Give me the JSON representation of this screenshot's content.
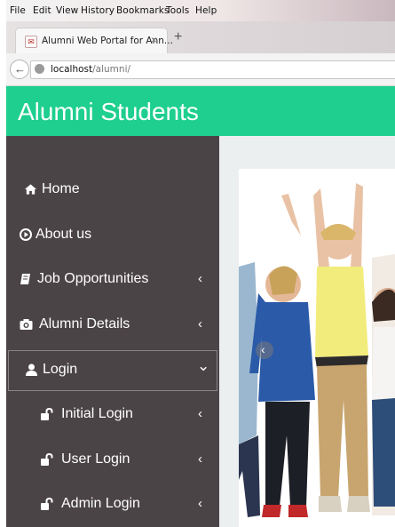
{
  "browser": {
    "menu": [
      "File",
      "Edit",
      "View",
      "History",
      "Bookmarks",
      "Tools",
      "Help"
    ],
    "tab": {
      "title": "Alumni Web Portal for Ann...",
      "close": "×"
    },
    "new_tab": "+",
    "url": {
      "host": "localhost",
      "path": "/alumni/"
    }
  },
  "header": {
    "brand": "Alumni Students",
    "color": "#1ecf8f"
  },
  "sidebar": {
    "background": "#4b4447",
    "items": [
      {
        "label": "Home",
        "icon": "home-icon",
        "chevron": ""
      },
      {
        "label": "About us",
        "icon": "play-circle-icon",
        "chevron": ""
      },
      {
        "label": "Job Opportunities",
        "icon": "book-icon",
        "chevron": "‹"
      },
      {
        "label": "Alumni Details",
        "icon": "camera-icon",
        "chevron": "‹"
      },
      {
        "label": "Login",
        "icon": "user-icon",
        "chevron": "⌄",
        "active": true
      },
      {
        "label": "Initial Login",
        "icon": "unlock-icon",
        "chevron": "‹"
      },
      {
        "label": "User Login",
        "icon": "unlock-icon",
        "chevron": "‹"
      },
      {
        "label": "Admin Login",
        "icon": "unlock-icon",
        "chevron": "‹"
      }
    ]
  },
  "slider": {
    "image": "group-of-students-celebrating",
    "prev_icon": "chevron-left-icon"
  }
}
